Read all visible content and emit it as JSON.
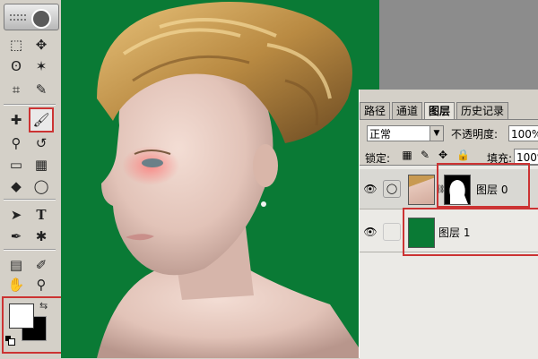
{
  "toolbox": {
    "tools": [
      {
        "name": "marquee-tool-icon",
        "glyph": "⬚"
      },
      {
        "name": "move-tool-icon",
        "glyph": "✥"
      },
      {
        "name": "lasso-tool-icon",
        "glyph": "ʘ"
      },
      {
        "name": "magic-wand-tool-icon",
        "glyph": "✶"
      },
      {
        "name": "crop-tool-icon",
        "glyph": "⌗"
      },
      {
        "name": "slice-tool-icon",
        "glyph": "✎"
      },
      {
        "name": "healing-brush-tool-icon",
        "glyph": "✚"
      },
      {
        "name": "brush-tool-icon",
        "glyph": "🖌"
      },
      {
        "name": "clone-stamp-tool-icon",
        "glyph": "⚲"
      },
      {
        "name": "history-brush-tool-icon",
        "glyph": "↺"
      },
      {
        "name": "eraser-tool-icon",
        "glyph": "▭"
      },
      {
        "name": "gradient-tool-icon",
        "glyph": "▦"
      },
      {
        "name": "blur-tool-icon",
        "glyph": "◆"
      },
      {
        "name": "dodge-tool-icon",
        "glyph": "◯"
      },
      {
        "name": "path-selection-tool-icon",
        "glyph": "➤"
      },
      {
        "name": "type-tool-icon",
        "glyph": "T"
      },
      {
        "name": "pen-tool-icon",
        "glyph": "✒"
      },
      {
        "name": "shape-tool-icon",
        "glyph": "✱"
      },
      {
        "name": "notes-tool-icon",
        "glyph": "▤"
      },
      {
        "name": "eyedropper-tool-icon",
        "glyph": "✐"
      },
      {
        "name": "hand-tool-icon",
        "glyph": "✋"
      },
      {
        "name": "zoom-tool-icon",
        "glyph": "⚲"
      }
    ]
  },
  "layers_panel": {
    "tabs": [
      {
        "label": "路径"
      },
      {
        "label": "通道"
      },
      {
        "label": "图层"
      },
      {
        "label": "历史记录"
      }
    ],
    "blend_mode": "正常",
    "opacity_label": "不透明度:",
    "opacity_value": "100%",
    "lock_label": "锁定:",
    "fill_label": "填充:",
    "fill_value": "100%",
    "layers": [
      {
        "name": "图层 0"
      },
      {
        "name": "图层 1"
      }
    ]
  },
  "colors": {
    "canvas_background": "#0a7a35",
    "foreground": "#ffffff",
    "background": "#000000",
    "highlight": "#cc3333"
  }
}
